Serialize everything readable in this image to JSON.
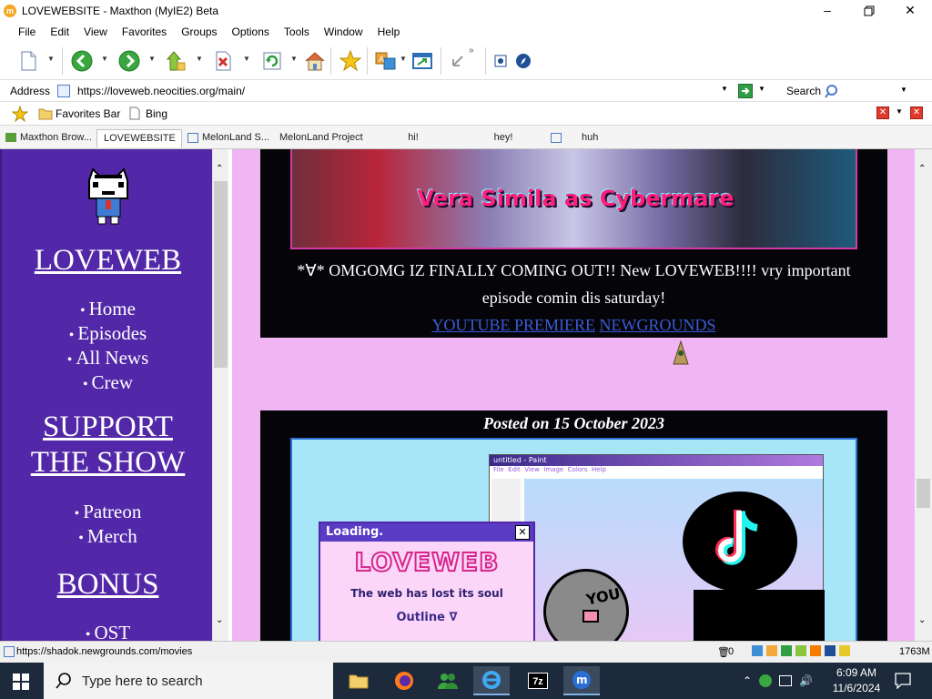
{
  "window": {
    "title": "LOVEWEBSITE - Maxthon (MyIE2) Beta",
    "app_icon": "maxthon-icon",
    "controls": [
      "minimize",
      "maximize",
      "close"
    ]
  },
  "menu": [
    "File",
    "Edit",
    "View",
    "Favorites",
    "Groups",
    "Options",
    "Tools",
    "Window",
    "Help"
  ],
  "toolbar": {
    "icons": [
      "new-page-icon",
      "back-icon",
      "forward-icon",
      "up-icon",
      "stop-icon",
      "refresh-icon",
      "home-icon",
      "favorites-star-icon",
      "translate-icon",
      "maximize-window-icon",
      "collapse-icon",
      "options-icon",
      "compass-icon"
    ]
  },
  "address": {
    "label": "Address",
    "url": "https://loveweb.neocities.org/main/",
    "search_label": "Search"
  },
  "favorites": {
    "folder_label": "Favorites Bar",
    "item_label": "Bing"
  },
  "tabs": [
    {
      "label": "Maxthon Brow..."
    },
    {
      "label": "LOVEWEBSITE",
      "active": true
    },
    {
      "label": "MelonLand S..."
    },
    {
      "label": "MelonLand Project"
    },
    {
      "label": "hi!"
    },
    {
      "label": "hey!"
    },
    {
      "label": "huh"
    }
  ],
  "sidebar": {
    "title": "LOVEWEB",
    "nav": [
      "Home",
      "Episodes",
      "All News",
      "Crew"
    ],
    "support_title_1": "SUPPORT",
    "support_title_2": "THE SHOW",
    "support": [
      "Patreon",
      "Merch"
    ],
    "bonus_title": "BONUS",
    "bonus": [
      "OST"
    ]
  },
  "post1": {
    "image_caption": "Vera Simila as Cybermare",
    "text_line1": "*∀* OMGOMG IZ FINALLY COMING OUT!! New LOVEWEB!!!! vry important",
    "text_line2": "episode comin dis saturday!",
    "link1": "YOUTUBE PREMIERE",
    "link2": "NEWGROUNDS"
  },
  "post2": {
    "date": "Posted on 15 October 2023",
    "paint_title": "untitled - Paint",
    "paint_menu": [
      "File",
      "Edit",
      "View",
      "Image",
      "Colors",
      "Help"
    ],
    "loading_title": "Loading.",
    "loading_logo": "LOVEWEB",
    "loading_sub": "The web has lost its soul",
    "loading_outline": "Outline",
    "face_text": "YOU"
  },
  "status": {
    "url": "https://shadok.newgrounds.com/movies",
    "count": "0",
    "memory": "1763M"
  },
  "taskbar": {
    "search_placeholder": "Type here to search",
    "time": "6:09 AM",
    "date": "11/6/2024",
    "apps": [
      "file-explorer-icon",
      "firefox-icon",
      "people-icon",
      "internet-explorer-icon",
      "7zip-icon",
      "maxthon-icon"
    ]
  },
  "colors": {
    "sidebar_bg": "#5228a8",
    "main_bg": "#f0b6f4",
    "post_bg": "#050509",
    "link": "#3b5bd6",
    "taskbar": "#1c2a3c"
  }
}
